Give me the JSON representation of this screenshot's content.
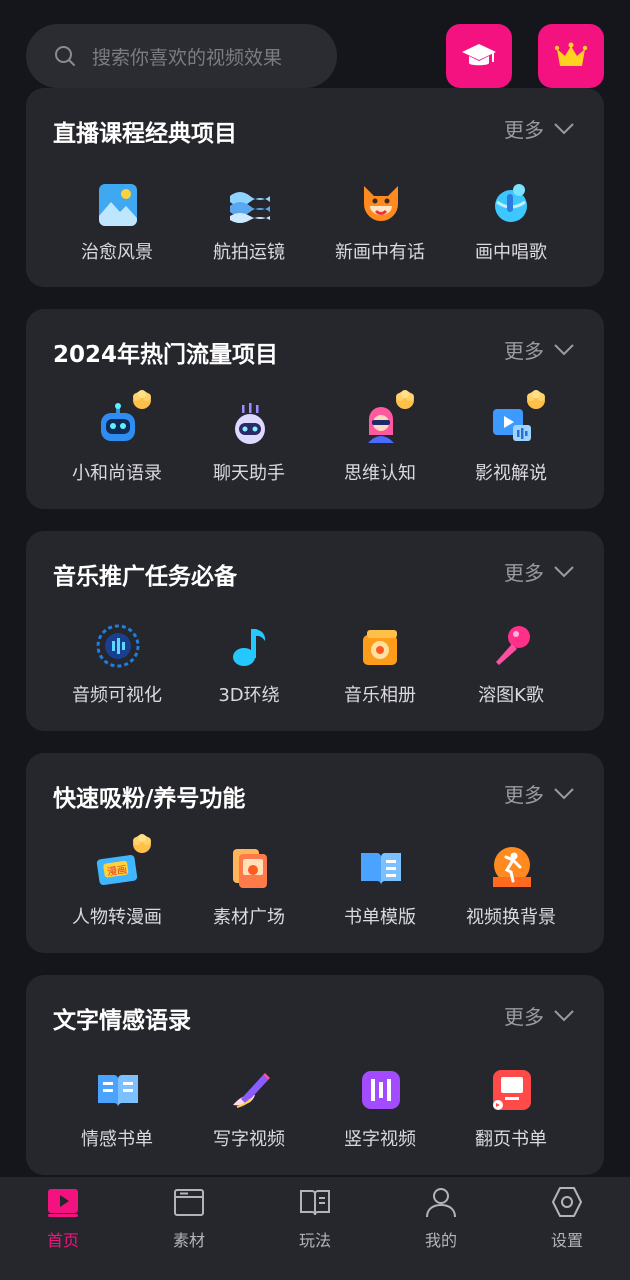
{
  "search": {
    "placeholder": "搜索你喜欢的视频效果",
    "icon": "search-icon"
  },
  "top_buttons": [
    {
      "icon": "graduation-cap-icon",
      "color": "#f3127f"
    },
    {
      "icon": "crown-icon",
      "color": "#f3127f"
    }
  ],
  "sections": [
    {
      "title": "直播课程经典项目",
      "more": "更多",
      "items": [
        {
          "label": "治愈风景",
          "icon": "landscape-icon",
          "hot": false
        },
        {
          "label": "航拍运镜",
          "icon": "aerial-waves-icon",
          "hot": false
        },
        {
          "label": "新画中有话",
          "icon": "fox-icon",
          "hot": false
        },
        {
          "label": "画中唱歌",
          "icon": "globe-ball-icon",
          "hot": false
        }
      ]
    },
    {
      "title": "2024年热门流量项目",
      "more": "更多",
      "items": [
        {
          "label": "小和尚语录",
          "icon": "robot-icon",
          "hot": true
        },
        {
          "label": "聊天助手",
          "icon": "chat-robot-icon",
          "hot": false
        },
        {
          "label": "思维认知",
          "icon": "girl-avatar-icon",
          "hot": true
        },
        {
          "label": "影视解说",
          "icon": "video-narration-icon",
          "hot": true
        }
      ]
    },
    {
      "title": "音乐推广任务必备",
      "more": "更多",
      "items": [
        {
          "label": "音频可视化",
          "icon": "audio-visualizer-icon",
          "hot": false
        },
        {
          "label": "3D环绕",
          "icon": "music-note-icon",
          "hot": false
        },
        {
          "label": "音乐相册",
          "icon": "music-album-icon",
          "hot": false
        },
        {
          "label": "溶图K歌",
          "icon": "microphone-icon",
          "hot": false
        }
      ]
    },
    {
      "title": "快速吸粉/养号功能",
      "more": "更多",
      "items": [
        {
          "label": "人物转漫画",
          "icon": "comic-icon",
          "hot": true
        },
        {
          "label": "素材广场",
          "icon": "material-cards-icon",
          "hot": false
        },
        {
          "label": "书单模版",
          "icon": "book-template-icon",
          "hot": false
        },
        {
          "label": "视频换背景",
          "icon": "dancer-background-icon",
          "hot": false
        }
      ]
    },
    {
      "title": "文字情感语录",
      "more": "更多",
      "items": [
        {
          "label": "情感书单",
          "icon": "open-book-icon",
          "hot": false
        },
        {
          "label": "写字视频",
          "icon": "pen-writing-icon",
          "hot": false
        },
        {
          "label": "竖字视频",
          "icon": "vertical-text-icon",
          "hot": false
        },
        {
          "label": "翻页书单",
          "icon": "page-flip-book-icon",
          "hot": false
        }
      ]
    }
  ],
  "tabbar": {
    "active_color": "#f3127f",
    "tabs": [
      {
        "label": "首页",
        "icon": "home-play-icon",
        "active": true
      },
      {
        "label": "素材",
        "icon": "folder-icon",
        "active": false
      },
      {
        "label": "玩法",
        "icon": "book-icon",
        "active": false
      },
      {
        "label": "我的",
        "icon": "user-icon",
        "active": false
      },
      {
        "label": "设置",
        "icon": "settings-icon",
        "active": false
      }
    ]
  }
}
